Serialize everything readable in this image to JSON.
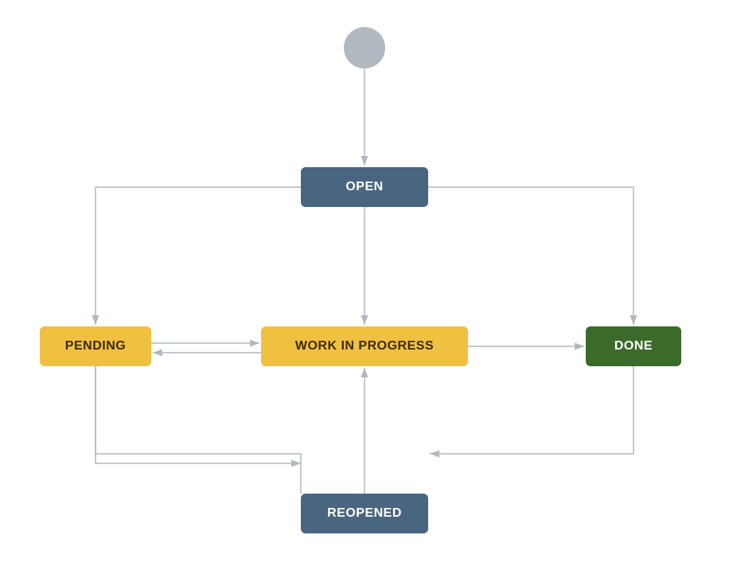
{
  "nodes": {
    "start": {
      "label": ""
    },
    "open": {
      "label": "OPEN"
    },
    "pending": {
      "label": "PENDING"
    },
    "wip": {
      "label": "WORK IN PROGRESS"
    },
    "done": {
      "label": "DONE"
    },
    "reopened": {
      "label": "REOPENED"
    }
  },
  "colors": {
    "line": "#b0b8c0",
    "open_bg": "#4a6580",
    "pending_bg": "#f0c040",
    "wip_bg": "#f0c040",
    "done_bg": "#3a6b2a",
    "reopened_bg": "#4a6580",
    "start_circle": "#b0b8c0"
  }
}
